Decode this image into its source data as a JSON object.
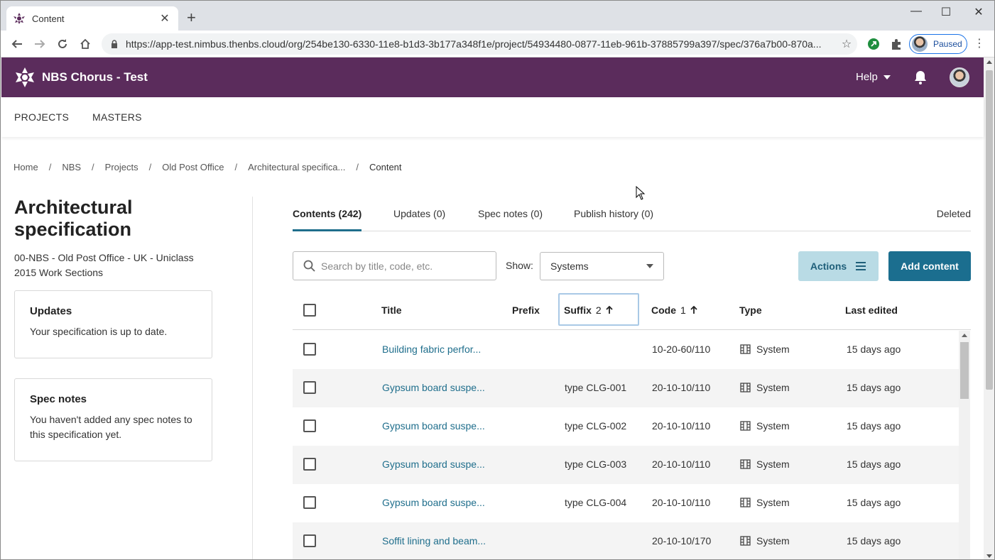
{
  "browser": {
    "tab_title": "Content",
    "url": "https://app-test.nimbus.thenbs.cloud/org/254be130-6330-11e8-b1d3-3b177a348f1e/project/54934480-0877-11eb-961b-37885799a397/spec/376a7b00-870a...",
    "profile_label": "Paused"
  },
  "header": {
    "app_name": "NBS Chorus - Test",
    "help_label": "Help",
    "brand_color": "#5b2c5c"
  },
  "subnav": {
    "projects": "PROJECTS",
    "masters": "MASTERS"
  },
  "breadcrumb": [
    "Home",
    "NBS",
    "Projects",
    "Old Post Office",
    "Architectural specifica...",
    "Content"
  ],
  "sidebar": {
    "title": "Architectural specification",
    "description": "00-NBS - Old Post Office - UK - Uniclass 2015 Work Sections",
    "updates_card": {
      "heading": "Updates",
      "text": "Your specification is up to date."
    },
    "notes_card": {
      "heading": "Spec notes",
      "text": "You haven't added any spec notes to this specification yet."
    }
  },
  "tabs": {
    "contents": "Contents (242)",
    "updates": "Updates (0)",
    "spec_notes": "Spec notes (0)",
    "publish_history": "Publish history (0)",
    "deleted": "Deleted"
  },
  "toolbar": {
    "search_placeholder": "Search by title, code, etc.",
    "show_label": "Show:",
    "show_value": "Systems",
    "actions_label": "Actions",
    "add_label": "Add content",
    "accent_color": "#1b6e8f"
  },
  "table": {
    "headers": {
      "title": "Title",
      "prefix": "Prefix",
      "suffix": "Suffix",
      "suffix_sort": "2",
      "code": "Code",
      "code_sort": "1",
      "type": "Type",
      "last_edited": "Last edited"
    },
    "rows": [
      {
        "title": "Building fabric perfor...",
        "prefix": "",
        "suffix": "",
        "code": "10-20-60/110",
        "type": "System",
        "edited": "15 days ago"
      },
      {
        "title": "Gypsum board suspe...",
        "prefix": "",
        "suffix": "type CLG-001",
        "code": "20-10-10/110",
        "type": "System",
        "edited": "15 days ago"
      },
      {
        "title": "Gypsum board suspe...",
        "prefix": "",
        "suffix": "type CLG-002",
        "code": "20-10-10/110",
        "type": "System",
        "edited": "15 days ago"
      },
      {
        "title": "Gypsum board suspe...",
        "prefix": "",
        "suffix": "type CLG-003",
        "code": "20-10-10/110",
        "type": "System",
        "edited": "15 days ago"
      },
      {
        "title": "Gypsum board suspe...",
        "prefix": "",
        "suffix": "type CLG-004",
        "code": "20-10-10/110",
        "type": "System",
        "edited": "15 days ago"
      },
      {
        "title": "Soffit lining and beam...",
        "prefix": "",
        "suffix": "",
        "code": "20-10-10/170",
        "type": "System",
        "edited": "15 days ago"
      }
    ]
  }
}
